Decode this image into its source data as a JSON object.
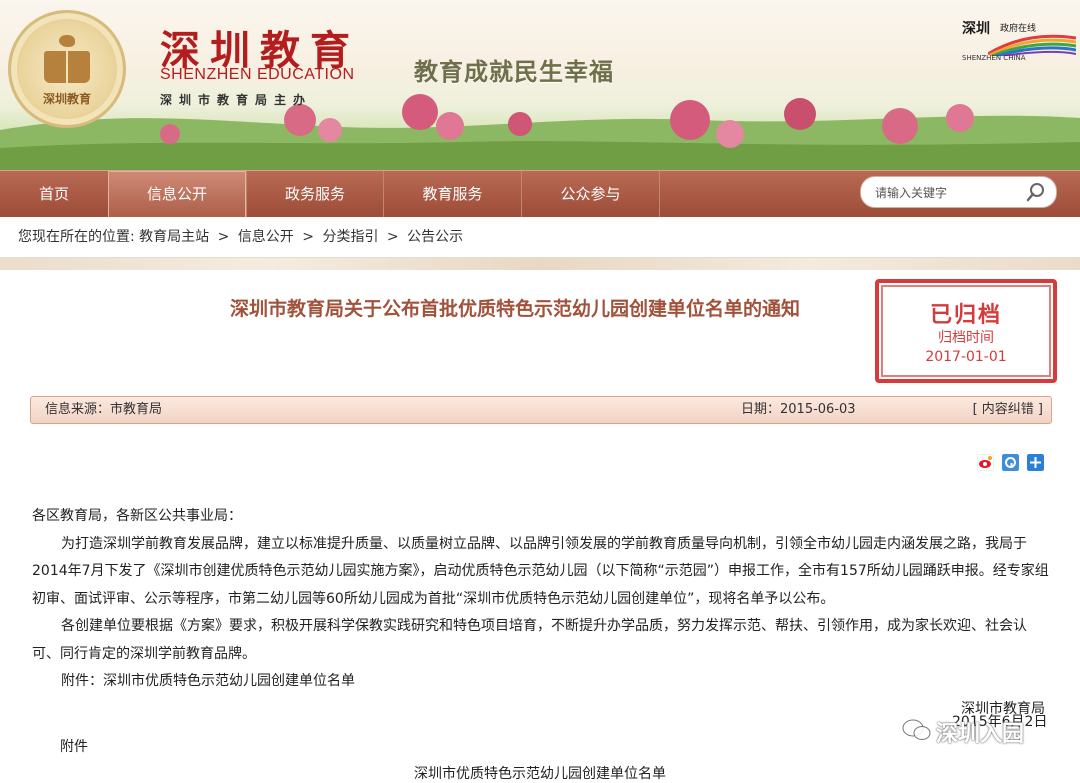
{
  "banner": {
    "seal_text": "深圳教育",
    "brand_cn": "深圳教育",
    "brand_en": "SHENZHEN EDUCATION",
    "brand_sub": "深圳市教育局主办",
    "slogan": "教育成就民生幸福",
    "sz_logo_cn": "深圳",
    "sz_logo_cn2": "政府在线",
    "sz_logo_en": "SHENZHEN CHINA"
  },
  "nav": {
    "items": [
      "首页",
      "信息公开",
      "政务服务",
      "教育服务",
      "公众参与"
    ],
    "active_index": 1,
    "search_placeholder": "请输入关键字"
  },
  "breadcrumb": {
    "prefix": "您现在所在的位置:",
    "items": [
      "教育局主站",
      "信息公开",
      "分类指引",
      "公告公示"
    ],
    "separator": ">"
  },
  "article": {
    "title": "深圳市教育局关于公布首批优质特色示范幼儿园创建单位名单的通知",
    "stamp": {
      "line1": "已归档",
      "line2": "归档时间",
      "line3": "2017-01-01"
    },
    "source_label": "信息来源：市教育局",
    "date_label": "日期：2015-06-03",
    "error_link": "[ 内容纠错 ]",
    "greeting": "各区教育局，各新区公共事业局：",
    "paragraph1": "为打造深圳学前教育发展品牌，建立以标准提升质量、以质量树立品牌、以品牌引领发展的学前教育质量导向机制，引领全市幼儿园走内涵发展之路，我局于2014年7月下发了《深圳市创建优质特色示范幼儿园实施方案》，启动优质特色示范幼儿园（以下简称“示范园”）申报工作，全市有157所幼儿园踊跃申报。经专家组初审、面试评审、公示等程序，市第二幼儿园等60所幼儿园成为首批“深圳市优质特色示范幼儿园创建单位”，现将名单予以公布。",
    "paragraph2": "各创建单位要根据《方案》要求，积极开展科学保教实践研究和特色项目培育，不断提升办学品质，努力发挥示范、帮扶、引领作用，成为家长欢迎、社会认可、同行肯定的深圳学前教育品牌。",
    "attachment_line": "附件：深圳市优质特色示范幼儿园创建单位名单",
    "signature": "深圳市教育局",
    "sign_date": "2015年6月2日",
    "annex_label": "附件",
    "annex_title": "深圳市优质特色示范幼儿园创建单位名单"
  },
  "watermark": "深圳入园",
  "colors": {
    "nav": "#9c4b36",
    "title": "#a0523b",
    "stamp": "#d63a3a",
    "brand": "#b41d1d"
  }
}
